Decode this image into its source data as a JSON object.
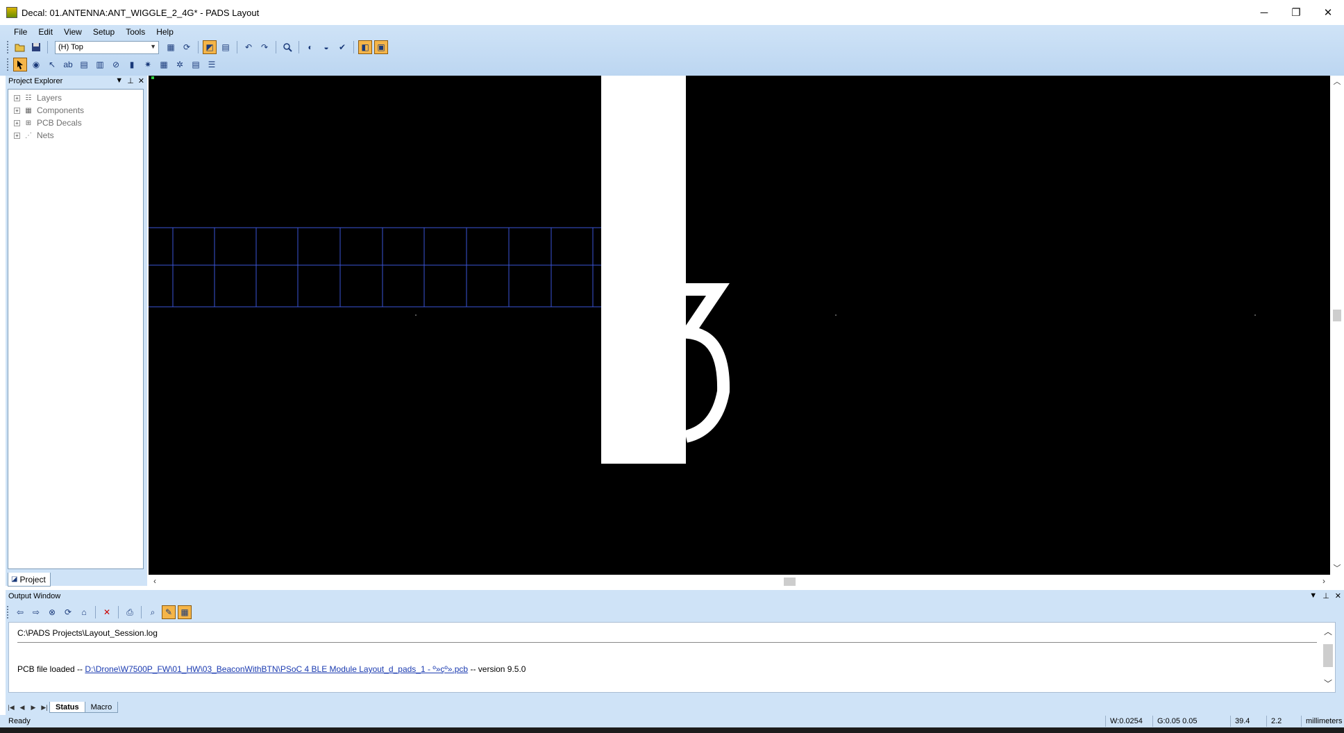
{
  "window": {
    "title": "Decal: 01.ANTENNA:ANT_WIGGLE_2_4G* - PADS Layout",
    "minimize": "─",
    "restore": "❐",
    "close": "✕"
  },
  "menu": [
    {
      "label": "File"
    },
    {
      "label": "Edit"
    },
    {
      "label": "View"
    },
    {
      "label": "Setup"
    },
    {
      "label": "Tools"
    },
    {
      "label": "Help"
    }
  ],
  "toolbar": {
    "layer_select": "(H) Top"
  },
  "explorer": {
    "title": "Project Explorer",
    "tree": [
      {
        "label": "Layers"
      },
      {
        "label": "Components"
      },
      {
        "label": "PCB Decals"
      },
      {
        "label": "Nets"
      }
    ],
    "tab_label": "Project"
  },
  "output": {
    "title": "Output Window",
    "log_path": "C:\\PADS Projects\\Layout_Session.log",
    "pcb_loaded_prefix": "PCB file loaded -- ",
    "pcb_file": "D:\\Drone\\W7500P_FW\\01_HW\\03_BeaconWithBTN\\PSoC 4 BLE Module Layout_d_pads_1 - º»çº».pcb",
    "pcb_loaded_suffix": " -- version 9.5.0",
    "tabs": [
      {
        "label": "Status",
        "active": true
      },
      {
        "label": "Macro",
        "active": false
      }
    ]
  },
  "statusbar": {
    "status": "Ready",
    "width": "W:0.0254",
    "grid": "G:0.05 0.05",
    "x": "39.4",
    "y": "2.2",
    "units": "millimeters"
  },
  "colors": {
    "chrome_blue": "#cfe3f7",
    "canvas_bg": "#000000",
    "grid_line": "#3a55d6",
    "copper_white": "#ffffff"
  }
}
